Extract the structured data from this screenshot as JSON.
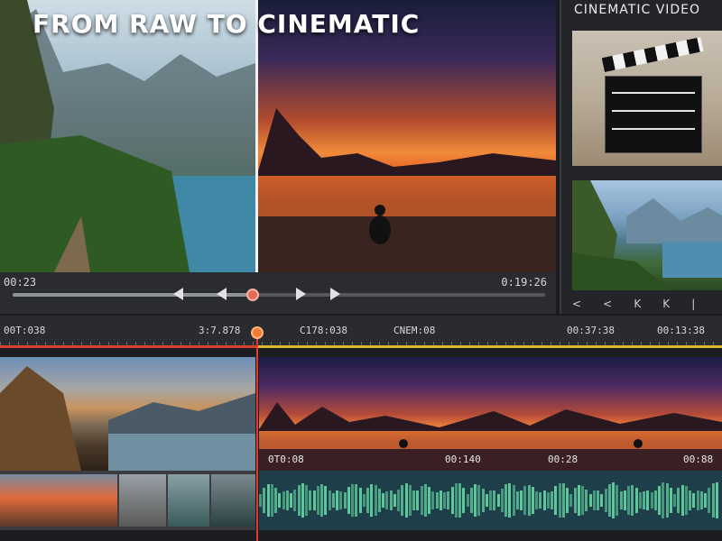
{
  "preview": {
    "title": "FROM RAW TO CINEMATIC",
    "timecode_left": "00:23",
    "timecode_right": "0:19:26",
    "scrub_progress": 0.45
  },
  "media_panel": {
    "title": "CINEMATIC VIDEO",
    "controls": [
      "<",
      "<",
      "K",
      "K",
      "|"
    ]
  },
  "timeline": {
    "ruler_labels": [
      "00T:038",
      "3:7.878",
      "C178:038",
      "CNEM:08",
      "00:37:38",
      "00:13:38"
    ],
    "clip_a_timecode": "",
    "clip_b_timecodes": [
      "0T0:08",
      "00:140",
      "00:28",
      "00:88"
    ],
    "playhead_position": 0.36
  },
  "colors": {
    "accent_red": "#e03b2e",
    "accent_yellow": "#d9b82a",
    "waveform": "#69e0a8"
  }
}
